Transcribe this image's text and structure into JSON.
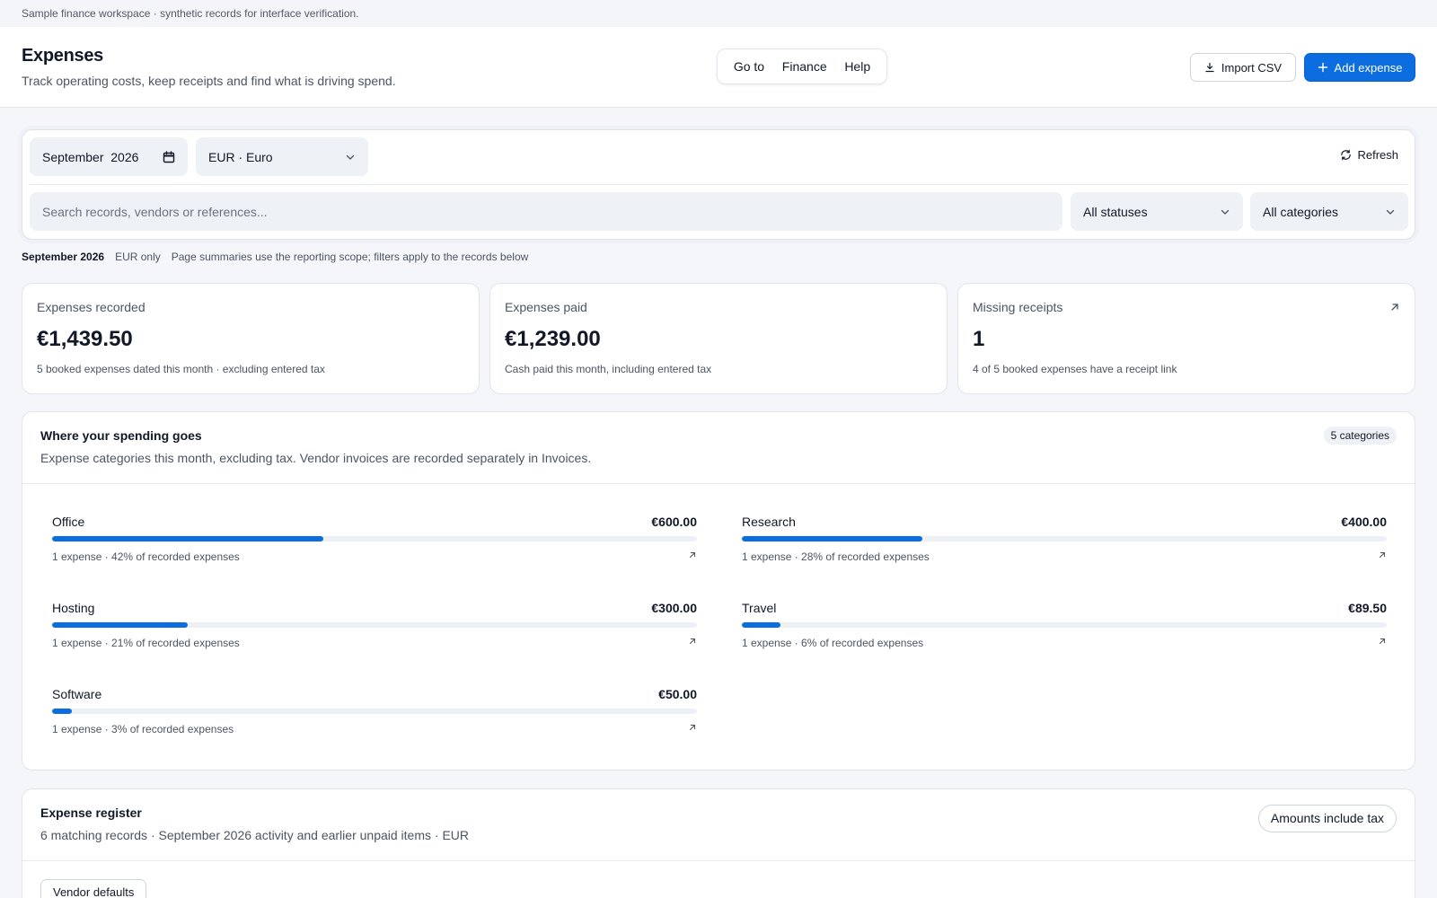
{
  "notice": "Sample finance workspace · synthetic records for interface verification.",
  "header": {
    "title": "Expenses",
    "subtitle": "Track operating costs, keep receipts and find what is driving spend.",
    "nav": [
      "Go to",
      "Finance",
      "Help"
    ],
    "import_label": "Import CSV",
    "add_label": "Add expense"
  },
  "filters": {
    "month": "September  2026",
    "currency": "EUR · Euro",
    "refresh_label": "Refresh",
    "search_placeholder": "Search records, vendors or references...",
    "status": "All statuses",
    "category": "All categories"
  },
  "scope": {
    "period": "September 2026",
    "currency": "EUR only",
    "note": "Page summaries use the reporting scope; filters apply to the records below"
  },
  "kpis": [
    {
      "label": "Expenses recorded",
      "value": "€1,439.50",
      "sub": "5 booked expenses dated this month · excluding entered tax"
    },
    {
      "label": "Expenses paid",
      "value": "€1,239.00",
      "sub": "Cash paid this month, including entered tax"
    },
    {
      "label": "Missing receipts",
      "value": "1",
      "sub": "4 of 5 booked expenses have a receipt link"
    }
  ],
  "spend": {
    "title": "Where your spending goes",
    "description": "Expense categories this month, excluding tax. Vendor invoices are recorded separately in Invoices.",
    "badge": "5 categories",
    "categories": [
      {
        "name": "Office",
        "amount": "€600.00",
        "meta": "1 expense · 42% of recorded expenses",
        "percent": 42
      },
      {
        "name": "Research",
        "amount": "€400.00",
        "meta": "1 expense · 28% of recorded expenses",
        "percent": 28
      },
      {
        "name": "Hosting",
        "amount": "€300.00",
        "meta": "1 expense · 21% of recorded expenses",
        "percent": 21
      },
      {
        "name": "Travel",
        "amount": "€89.50",
        "meta": "1 expense · 6% of recorded expenses",
        "percent": 6
      },
      {
        "name": "Software",
        "amount": "€50.00",
        "meta": "1 expense · 3% of recorded expenses",
        "percent": 3
      }
    ]
  },
  "register": {
    "title": "Expense register",
    "description": "6 matching records · September 2026 activity and earlier unpaid items · EUR",
    "tax_pill": "Amounts include tax",
    "vendor_defaults": "Vendor defaults"
  },
  "colors": {
    "accent": "#0b6de0",
    "track": "#edf0f4"
  }
}
